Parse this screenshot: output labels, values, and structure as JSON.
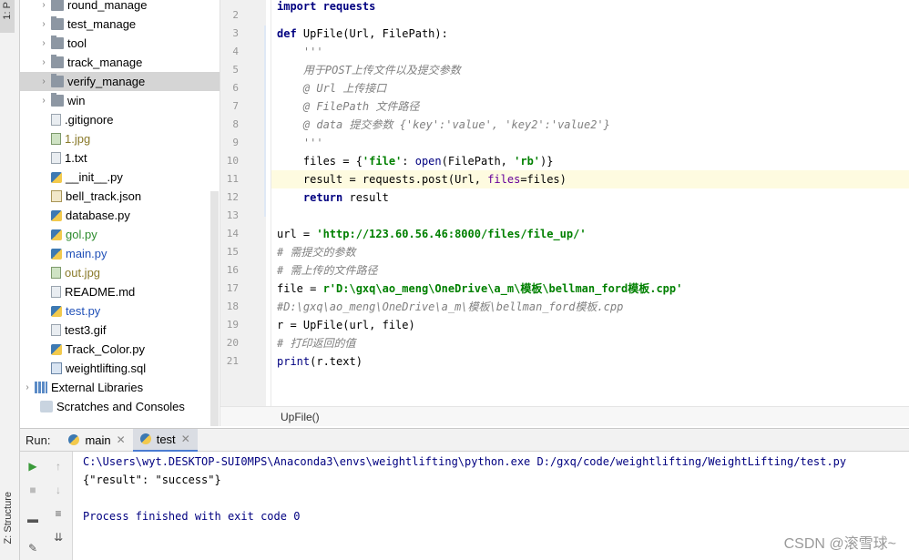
{
  "left_strip": {
    "project_tab": "1: P",
    "structure_tab": "Z: Structure"
  },
  "project_tree": [
    {
      "label": "round_manage",
      "type": "folder",
      "color": "default"
    },
    {
      "label": "test_manage",
      "type": "folder",
      "color": "default"
    },
    {
      "label": "tool",
      "type": "folder",
      "color": "default"
    },
    {
      "label": "track_manage",
      "type": "folder",
      "color": "default"
    },
    {
      "label": "verify_manage",
      "type": "folder",
      "color": "default",
      "selected": true
    },
    {
      "label": "win",
      "type": "folder",
      "color": "default"
    },
    {
      "label": ".gitignore",
      "type": "file",
      "color": "default"
    },
    {
      "label": "1.jpg",
      "type": "img",
      "color": "olive"
    },
    {
      "label": "1.txt",
      "type": "file",
      "color": "default"
    },
    {
      "label": "__init__.py",
      "type": "py",
      "color": "default"
    },
    {
      "label": "bell_track.json",
      "type": "json",
      "color": "default"
    },
    {
      "label": "database.py",
      "type": "py",
      "color": "default"
    },
    {
      "label": "gol.py",
      "type": "py",
      "color": "green"
    },
    {
      "label": "main.py",
      "type": "py",
      "color": "blue"
    },
    {
      "label": "out.jpg",
      "type": "img",
      "color": "olive"
    },
    {
      "label": "README.md",
      "type": "file",
      "color": "default"
    },
    {
      "label": "test.py",
      "type": "py",
      "color": "blue"
    },
    {
      "label": "test3.gif",
      "type": "file",
      "color": "default"
    },
    {
      "label": "Track_Color.py",
      "type": "py",
      "color": "default"
    },
    {
      "label": "weightlifting.sql",
      "type": "sql",
      "color": "default"
    },
    {
      "label": "External Libraries",
      "type": "lib",
      "color": "default"
    },
    {
      "label": "Scratches and Consoles",
      "type": "scratch",
      "color": "default"
    }
  ],
  "editor": {
    "line_numbers": [
      "2",
      "3",
      "4",
      "5",
      "6",
      "7",
      "8",
      "9",
      "10",
      "11",
      "12",
      "13",
      "14",
      "15",
      "16",
      "17",
      "18",
      "19",
      "20",
      "21"
    ],
    "line_fragments": {
      "l2": "import requests",
      "l3_def": "def",
      "l3_rest": " UpFile(Url, FilePath):",
      "l4": "    '''",
      "l5": "    用于POST上传文件以及提交参数",
      "l6": "    @ Url 上传接口",
      "l7": "    @ FilePath 文件路径",
      "l8": "    @ data 提交参数 {'key':'value', 'key2':'value2'}",
      "l9": "    '''",
      "l10_a": "    files = {",
      "l10_str1": "'file'",
      "l10_b": ": ",
      "l10_open": "open",
      "l10_c": "(FilePath, ",
      "l10_str2": "'rb'",
      "l10_d": ")}",
      "l11_a": "    result = requests.post(Url, ",
      "l11_par": "files",
      "l11_b": "=files)",
      "l12_ret": "    return",
      "l12_b": " result",
      "l14_a": "url = ",
      "l14_str": "'http://123.60.56.46:8000/files/file_up/'",
      "l15": "# 需提交的参数",
      "l16": "# 需上传的文件路径",
      "l17_a": "file = ",
      "l17_str": "r'D:\\gxq\\ao_meng\\OneDrive\\a_m\\模板\\bellman_ford模板.cpp'",
      "l18": "#D:\\gxq\\ao_meng\\OneDrive\\a_m\\模板\\bellman_ford模板.cpp",
      "l19": "r = UpFile(url, file)",
      "l20": "# 打印返回的值",
      "l21_print": "print",
      "l21_b": "(r.text)"
    },
    "breadcrumb": "UpFile()"
  },
  "run_panel": {
    "label": "Run:",
    "tabs": [
      {
        "label": "main",
        "active": false
      },
      {
        "label": "test",
        "active": true
      }
    ],
    "console": [
      "C:\\Users\\wyt.DESKTOP-SUI0MPS\\Anaconda3\\envs\\weightlifting\\python.exe D:/gxq/code/weightlifting/WeightLifting/test.py",
      "{\"result\": \"success\"}",
      "Process finished with exit code 0"
    ]
  },
  "watermark": "CSDN @滚雪球~",
  "colors": {
    "keyword": "#000080",
    "string": "#008000",
    "comment": "#808080",
    "param": "#660099",
    "caret_line": "#fefbe0",
    "selected_row": "#d5d5d5"
  }
}
